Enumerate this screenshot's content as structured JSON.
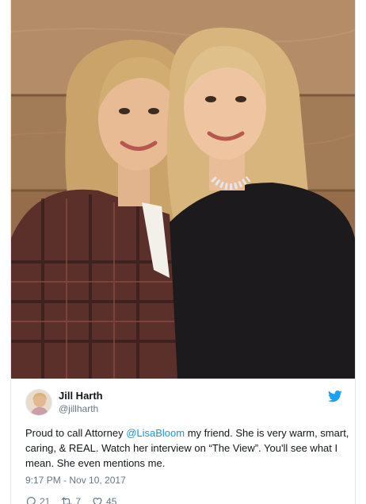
{
  "tweet": {
    "user": {
      "name": "Jill Harth",
      "handle": "@jillharth"
    },
    "text_parts": {
      "before_mention": "Proud to call Attorney ",
      "mention": "@LisaBloom",
      "after_mention": " my friend. She is very warm, smart, caring, & REAL. Watch her interview on “The View”. You'll see what I mean. She even mentions me."
    },
    "timestamp": "9:17 PM - Nov 10, 2017",
    "actions": {
      "replies": "21",
      "retweets": "7",
      "likes": "45"
    },
    "icons": {
      "brand": "twitter-bird-icon",
      "reply": "reply-icon",
      "retweet": "retweet-icon",
      "like": "heart-icon"
    }
  },
  "colors": {
    "brand_blue": "#1da1f2",
    "link_blue": "#1b95e0",
    "secondary_text": "#657786",
    "primary_text": "#14171a"
  }
}
